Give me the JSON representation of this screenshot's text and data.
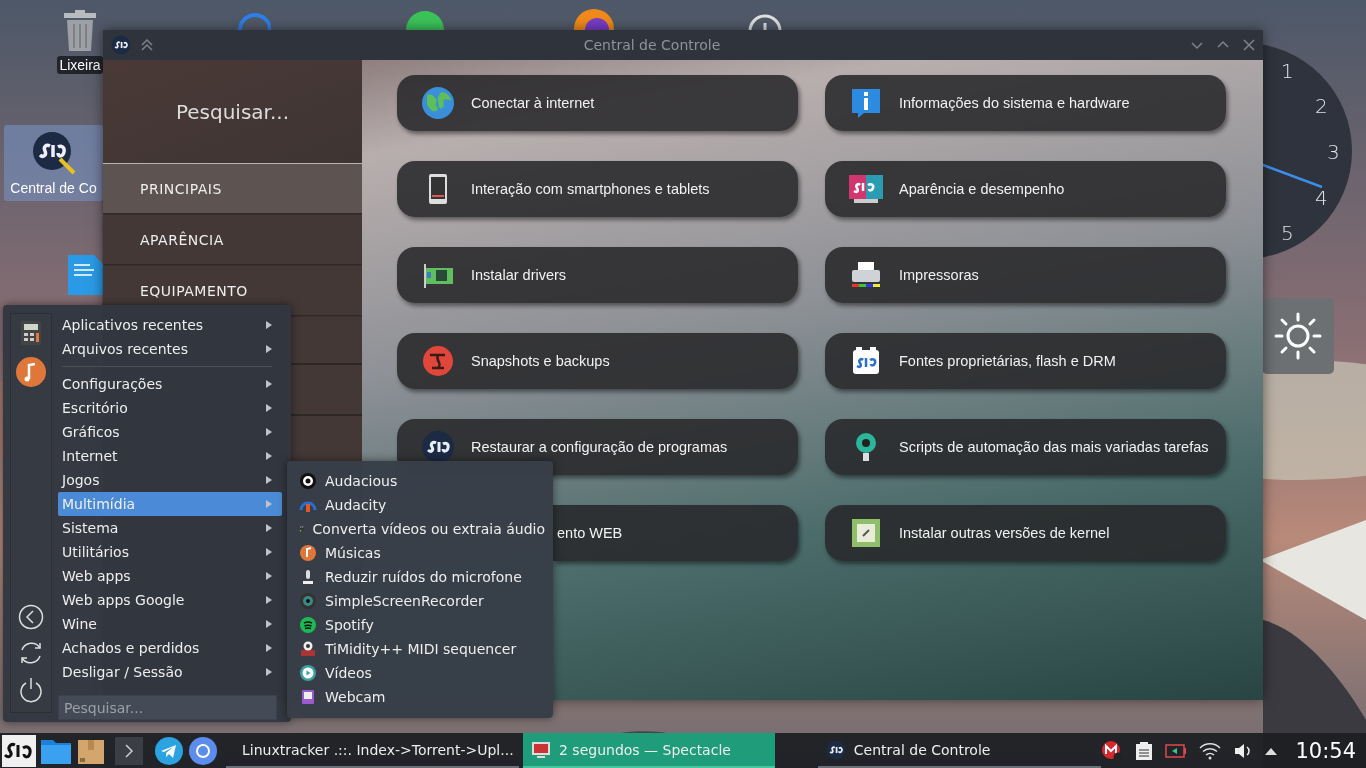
{
  "desktop_icons": [
    {
      "label": "Lixeira",
      "selected": false
    },
    {
      "label": "Central de Co",
      "selected": true
    }
  ],
  "clock_widget": {
    "numerals": [
      "1",
      "2",
      "3",
      "4",
      "5"
    ]
  },
  "window": {
    "title": "Central de Controle",
    "sidebar": {
      "search_placeholder": "Pesquisar...",
      "items": [
        {
          "label": "PRINCIPAIS",
          "selected": true
        },
        {
          "label": "APARÊNCIA",
          "selected": false
        },
        {
          "label": "EQUIPAMENTO",
          "selected": false
        }
      ]
    },
    "cards": [
      {
        "label": "Conectar à internet"
      },
      {
        "label": "Informações do sistema e hardware"
      },
      {
        "label": "Interação com smartphones e tablets"
      },
      {
        "label": "Aparência e desempenho"
      },
      {
        "label": "Instalar drivers"
      },
      {
        "label": "Impressoras"
      },
      {
        "label": "Snapshots e backups"
      },
      {
        "label": "Fontes proprietárias, flash e DRM"
      },
      {
        "label": "Restaurar a configuração de programas"
      },
      {
        "label": "Scripts de automação das mais variadas tarefas"
      },
      {
        "label": "ento WEB"
      },
      {
        "label": "Instalar outras versões de kernel"
      }
    ]
  },
  "start_menu": {
    "sections": [
      {
        "items": [
          {
            "label": "Aplicativos recentes",
            "selected": false
          },
          {
            "label": "Arquivos recentes",
            "selected": false
          }
        ]
      },
      {
        "items": [
          {
            "label": "Configurações",
            "selected": false
          },
          {
            "label": "Escritório",
            "selected": false
          },
          {
            "label": "Gráficos",
            "selected": false
          },
          {
            "label": "Internet",
            "selected": false
          },
          {
            "label": "Jogos",
            "selected": false
          },
          {
            "label": "Multimídia",
            "selected": true
          },
          {
            "label": "Sistema",
            "selected": false
          },
          {
            "label": "Utilitários",
            "selected": false
          },
          {
            "label": "Web apps",
            "selected": false
          },
          {
            "label": "Web apps Google",
            "selected": false
          },
          {
            "label": "Wine",
            "selected": false
          },
          {
            "label": "Achados e perdidos",
            "selected": false
          },
          {
            "label": "Desligar / Sessão",
            "selected": false
          }
        ]
      }
    ],
    "search_placeholder": "Pesquisar...",
    "submenu": [
      {
        "label": "Audacious"
      },
      {
        "label": "Audacity"
      },
      {
        "label": "Converta vídeos ou extraia áudio"
      },
      {
        "label": "Músicas"
      },
      {
        "label": "Reduzir ruídos do microfone"
      },
      {
        "label": "SimpleScreenRecorder"
      },
      {
        "label": "Spotify"
      },
      {
        "label": "TiMidity++ MIDI sequencer"
      },
      {
        "label": "Vídeos"
      },
      {
        "label": "Webcam"
      }
    ]
  },
  "taskbar": {
    "tasks": [
      {
        "label": "Linuxtracker .::. Index->Torrent->Upl...",
        "selected": false
      },
      {
        "label": "2 segundos — Spectacle",
        "selected": true
      },
      {
        "label": "Central de Controle",
        "selected": false
      }
    ],
    "clock": "10:54"
  }
}
